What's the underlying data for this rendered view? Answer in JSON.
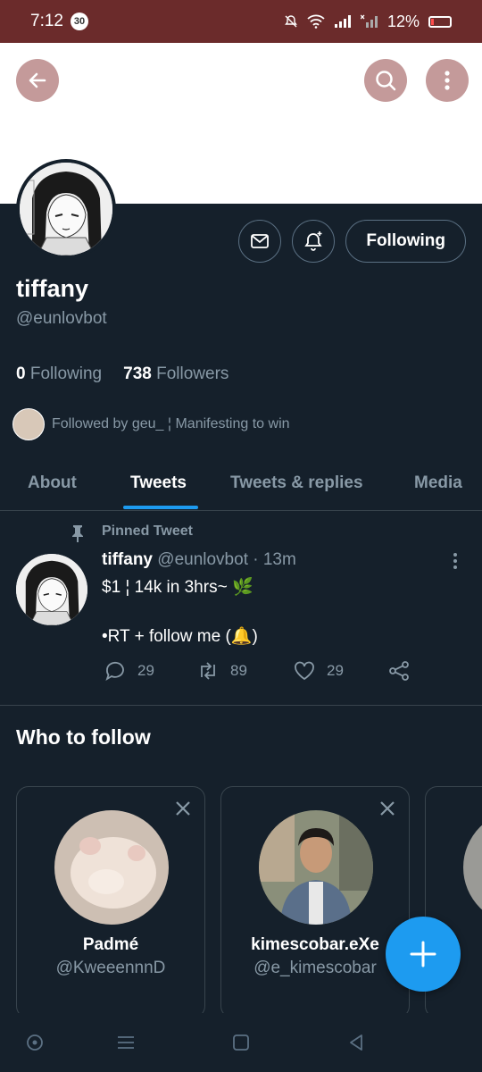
{
  "status_bar": {
    "time": "7:12",
    "notification_count": "30",
    "battery": "12%"
  },
  "profile": {
    "name": "tiffany",
    "handle": "@eunlovbot",
    "follow_button": "Following",
    "following_count": "0",
    "following_label": "Following",
    "followers_count": "738",
    "followers_label": "Followers",
    "followed_by": "Followed by geu_ ¦ Manifesting to win"
  },
  "tabs": [
    {
      "label": "About"
    },
    {
      "label": "Tweets"
    },
    {
      "label": "Tweets & replies"
    },
    {
      "label": "Media"
    }
  ],
  "active_tab": "Tweets",
  "pinned_tweet": {
    "label": "Pinned Tweet",
    "author": "tiffany",
    "meta": "@eunlovbot · 13m",
    "line1": "$1 ¦ 14k in 3hrs~ 🌿",
    "line2": "•RT + follow me (🔔)",
    "replies": "29",
    "retweets": "89",
    "likes": "29"
  },
  "who_to_follow": {
    "title": "Who to follow",
    "cards": [
      {
        "name": "Padmé",
        "handle": "@KweeennnD"
      },
      {
        "name": "kimescobar.eXe",
        "handle": "@e_kimescobar"
      }
    ]
  },
  "colors": {
    "accent": "#1d9bf0",
    "background": "#15202b",
    "status_bar": "#6b2b2b",
    "header": "#ffffff"
  }
}
